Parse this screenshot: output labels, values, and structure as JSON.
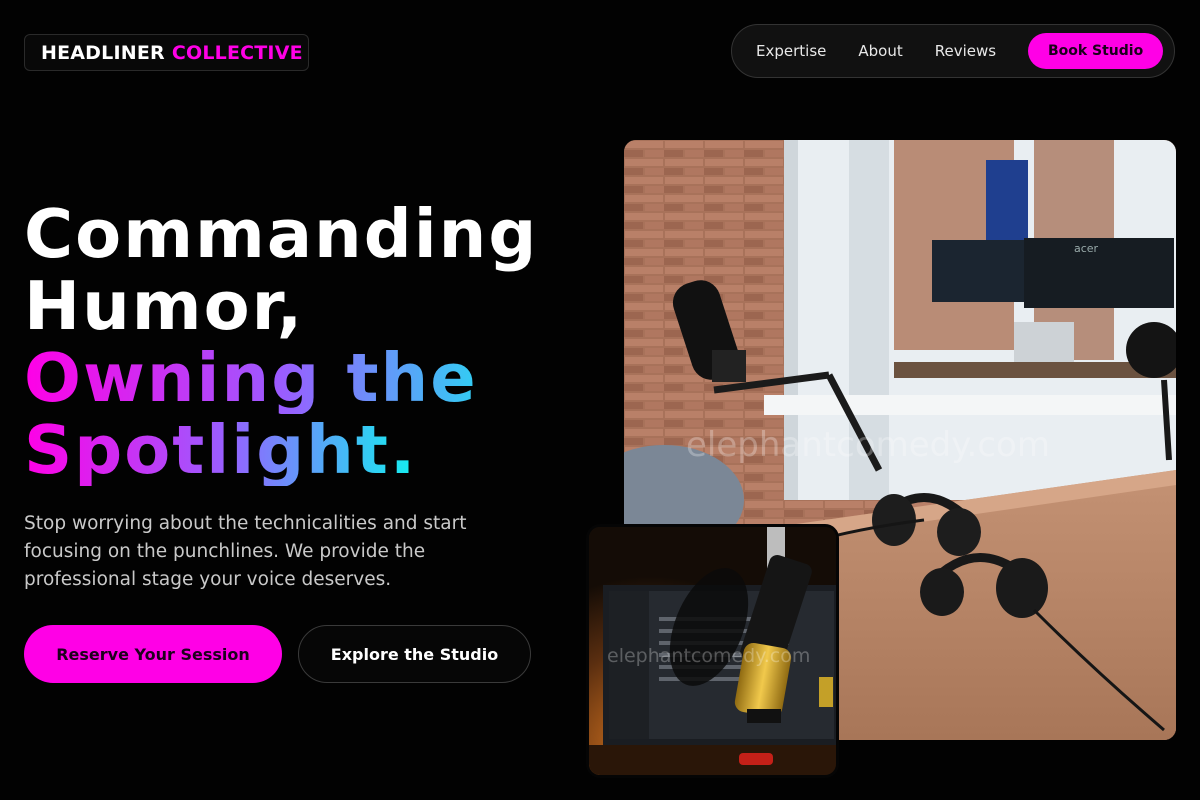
{
  "brand": {
    "part1": "HEADLINER",
    "part2": "COLLECTIVE"
  },
  "nav": {
    "links": [
      "Expertise",
      "About",
      "Reviews"
    ],
    "cta": "Book Studio"
  },
  "hero": {
    "line1": "Commanding",
    "line2": "Humor,",
    "line3": "Owning the",
    "line4": "Spotlight.",
    "subtitle": "Stop worrying about the technicalities and start focusing on the punchlines. We provide the professional stage your voice deserves.",
    "primary_cta": "Reserve Your Session",
    "secondary_cta": "Explore the Studio"
  },
  "images": {
    "watermark_main": "elephantcomedy.com",
    "watermark_small": "elephantcomedy.com",
    "monitor_brand": "acer"
  },
  "colors": {
    "accent": "#ff00e6",
    "background": "#020202",
    "gradient_start": "#ff00e6",
    "gradient_end": "#12f0f0"
  }
}
